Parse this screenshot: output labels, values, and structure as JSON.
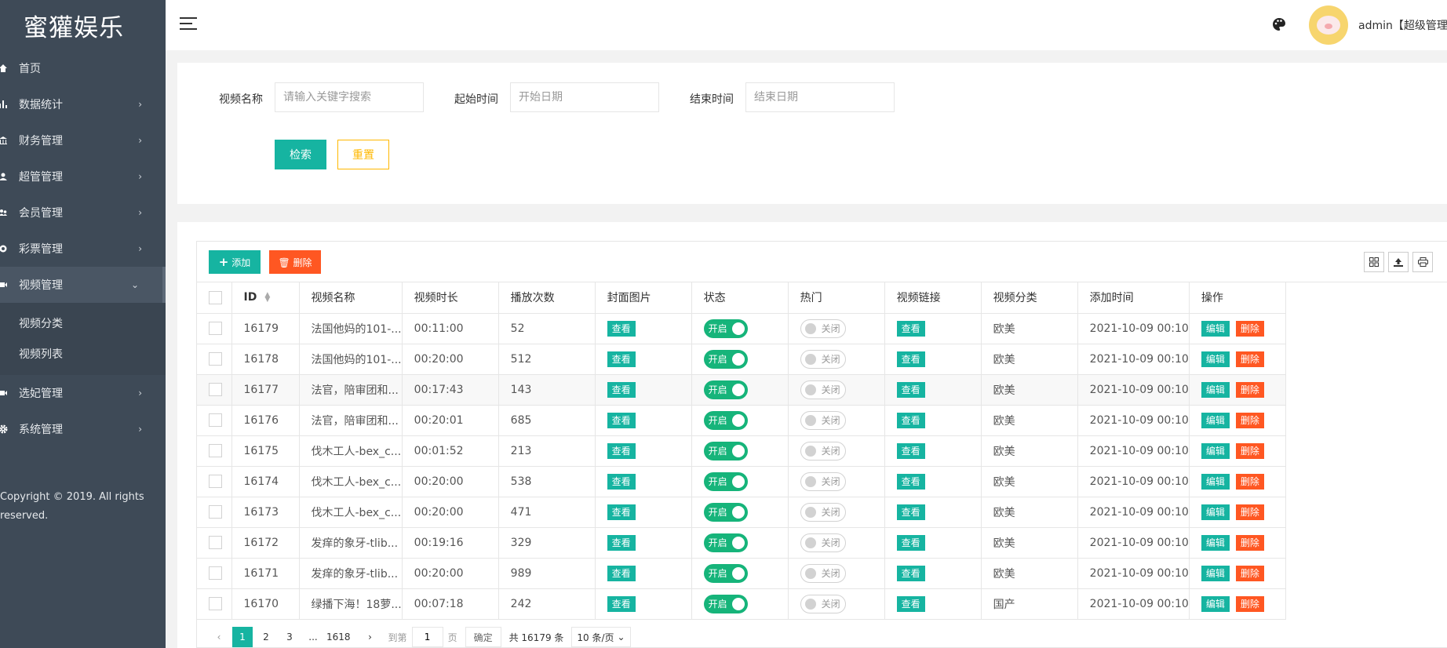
{
  "sidebar": {
    "logo": "蜜獾娱乐",
    "items": [
      {
        "label": "首页",
        "icon": "home-icon"
      },
      {
        "label": "数据统计",
        "icon": "bar-chart-icon"
      },
      {
        "label": "财务管理",
        "icon": "bank-icon"
      },
      {
        "label": "超管管理",
        "icon": "user-icon"
      },
      {
        "label": "会员管理",
        "icon": "users-icon"
      },
      {
        "label": "彩票管理",
        "icon": "lottery-icon"
      },
      {
        "label": "视频管理",
        "icon": "video-icon"
      },
      {
        "label": "选妃管理",
        "icon": "camera-icon"
      },
      {
        "label": "系统管理",
        "icon": "gear-icon"
      }
    ],
    "submenu": [
      "视频分类",
      "视频列表"
    ],
    "copyright_line1": "Copyright © 2019. All rights",
    "copyright_line2": "reserved."
  },
  "header": {
    "username": "admin【超级管理员"
  },
  "search": {
    "name_label": "视频名称",
    "name_placeholder": "请输入关键字搜索",
    "start_label": "起始时间",
    "start_placeholder": "开始日期",
    "end_label": "结束时间",
    "end_placeholder": "结束日期",
    "search_btn": "检索",
    "reset_btn": "重置"
  },
  "toolbar": {
    "add_label": "添加",
    "delete_label": "删除"
  },
  "table": {
    "headers": [
      "ID",
      "视频名称",
      "视频时长",
      "播放次数",
      "封面图片",
      "状态",
      "热门",
      "视频链接",
      "视频分类",
      "添加时间",
      "操作"
    ],
    "view_label": "查看",
    "on_label": "开启",
    "off_label": "关闭",
    "edit_label": "编辑",
    "delete_label": "删除",
    "rows": [
      {
        "id": "16179",
        "name": "法国他妈的101-...",
        "duration": "00:11:00",
        "plays": "52",
        "category": "欧美",
        "added": "2021-10-09 00:10"
      },
      {
        "id": "16178",
        "name": "法国他妈的101-...",
        "duration": "00:20:00",
        "plays": "512",
        "category": "欧美",
        "added": "2021-10-09 00:10"
      },
      {
        "id": "16177",
        "name": "法官，陪审团和...",
        "duration": "00:17:43",
        "plays": "143",
        "category": "欧美",
        "added": "2021-10-09 00:10"
      },
      {
        "id": "16176",
        "name": "法官，陪审团和...",
        "duration": "00:20:01",
        "plays": "685",
        "category": "欧美",
        "added": "2021-10-09 00:10"
      },
      {
        "id": "16175",
        "name": "伐木工人-bex_c...",
        "duration": "00:01:52",
        "plays": "213",
        "category": "欧美",
        "added": "2021-10-09 00:10"
      },
      {
        "id": "16174",
        "name": "伐木工人-bex_c...",
        "duration": "00:20:00",
        "plays": "538",
        "category": "欧美",
        "added": "2021-10-09 00:10"
      },
      {
        "id": "16173",
        "name": "伐木工人-bex_c...",
        "duration": "00:20:00",
        "plays": "471",
        "category": "欧美",
        "added": "2021-10-09 00:10"
      },
      {
        "id": "16172",
        "name": "发痒的象牙-tlib...",
        "duration": "00:19:16",
        "plays": "329",
        "category": "欧美",
        "added": "2021-10-09 00:10"
      },
      {
        "id": "16171",
        "name": "发痒的象牙-tlib...",
        "duration": "00:20:00",
        "plays": "989",
        "category": "欧美",
        "added": "2021-10-09 00:10"
      },
      {
        "id": "16170",
        "name": "绿播下海！18萝...",
        "duration": "00:07:18",
        "plays": "242",
        "category": "国产",
        "added": "2021-10-09 00:10"
      }
    ]
  },
  "pagination": {
    "pages": [
      "1",
      "2",
      "3"
    ],
    "ellipsis": "...",
    "last_page": "1618",
    "goto_label": "到第",
    "goto_value": "1",
    "page_unit": "页",
    "confirm": "确定",
    "total": "共 16179 条",
    "limit": "10 条/页"
  },
  "colors": {
    "sidebar_bg": "#3e4a57",
    "primary": "#16b4a1",
    "danger": "#ff5722",
    "warning": "#ffb800",
    "switch_on": "#16b47a"
  }
}
